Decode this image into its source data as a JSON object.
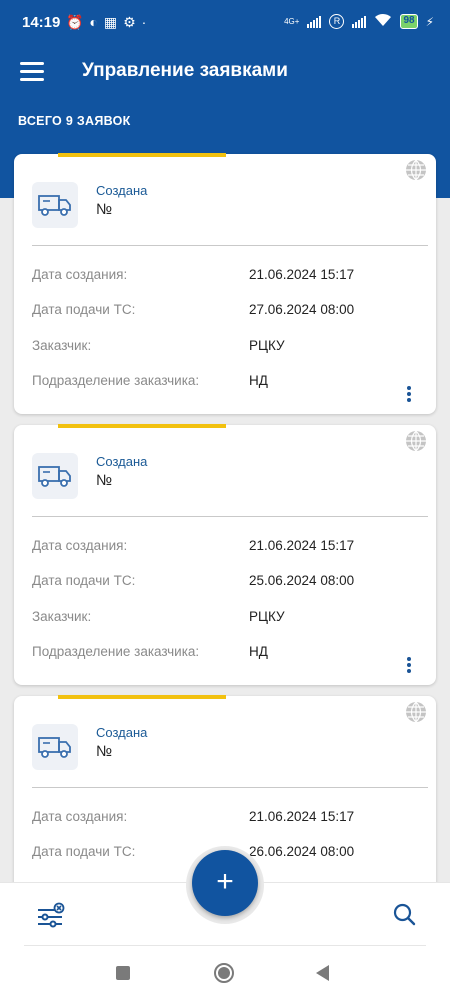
{
  "status_bar": {
    "time": "14:19",
    "battery": "98",
    "network": "4G+"
  },
  "header": {
    "title": "Управление заявками",
    "total": "ВСЕГО 9 ЗАЯВОК"
  },
  "labels": {
    "created": "Дата создания:",
    "delivery": "Дата подачи ТС:",
    "customer": "Заказчик:",
    "department": "Подразделение заказчика:"
  },
  "cards": [
    {
      "status": "Создана",
      "number": "№",
      "created": "21.06.2024 15:17",
      "delivery": "27.06.2024 08:00",
      "customer": "РЦКУ",
      "department": "НД"
    },
    {
      "status": "Создана",
      "number": "№",
      "created": "21.06.2024 15:17",
      "delivery": "25.06.2024 08:00",
      "customer": "РЦКУ",
      "department": "НД"
    },
    {
      "status": "Создана",
      "number": "№",
      "created": "21.06.2024 15:17",
      "delivery": "26.06.2024 08:00"
    }
  ],
  "fab": {
    "label": "+"
  },
  "colors": {
    "primary": "#1154a0",
    "accent": "#f2c10f",
    "status_text": "#1b5a96"
  }
}
